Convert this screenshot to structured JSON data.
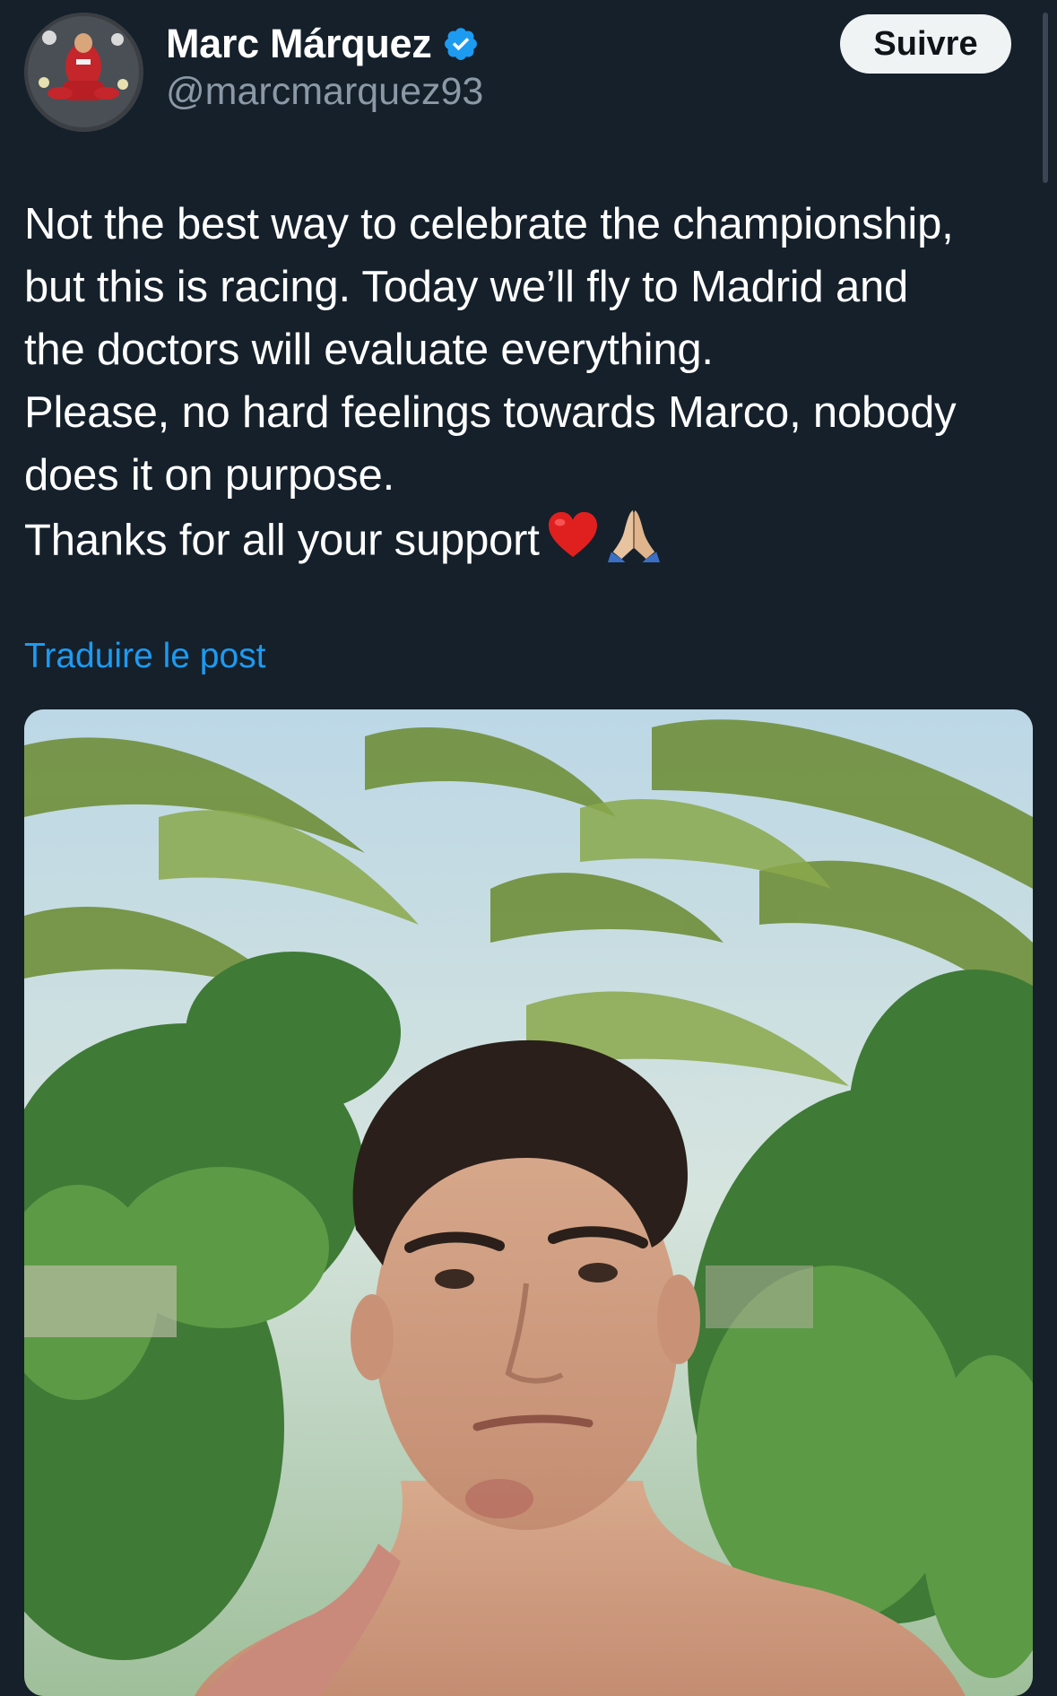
{
  "author": {
    "display_name": "Marc Márquez",
    "handle": "@marcmarquez93",
    "verified": true,
    "avatar_icon": "avatar-photo-rider-red-suit"
  },
  "follow_button": {
    "label": "Suivre"
  },
  "tweet": {
    "lines": [
      "Not the best way to celebrate the championship,",
      "but this is racing. Today we’ll fly to Madrid and",
      "the doctors will evaluate everything.",
      "Please, no hard feelings towards Marco, nobody",
      "does it on purpose.",
      "Thanks for all your support"
    ],
    "trailing_emojis": [
      "red-heart-emoji",
      "folded-hands-emoji"
    ]
  },
  "translate": {
    "label": "Traduire le post"
  },
  "media": {
    "type": "photo",
    "subject_icon": "selfie-palm-trees-photo"
  },
  "colors": {
    "background": "#15202b",
    "primary_text": "#ffffff",
    "secondary_text": "#8b98a5",
    "link": "#1d9bf0",
    "verified": "#1d9bf0",
    "follow_bg": "#eff3f4"
  }
}
